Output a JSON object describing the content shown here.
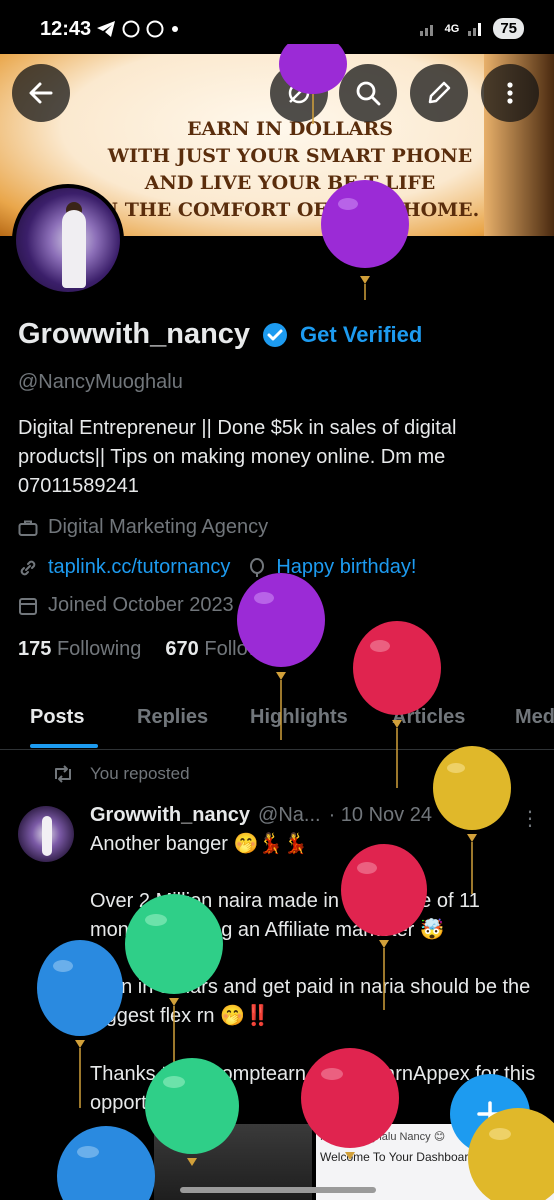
{
  "status_bar": {
    "time": "12:43",
    "battery": "75",
    "network": "4G"
  },
  "banner": {
    "lines": [
      "EARN IN DOLLARS",
      "WITH JUST YOUR SMART PHONE",
      "AND LIVE YOUR BE T LIFE",
      "N THE COMFORT OF YOUR HOME."
    ]
  },
  "profile": {
    "display_name": "Growwith_nancy",
    "get_verified": "Get Verified",
    "handle": "@NancyMuoghalu",
    "bio": "Digital Entrepreneur || Done $5k in sales of digital products|| Tips on making money online. Dm me 07011589241",
    "category": "Digital Marketing Agency",
    "website": "taplink.cc/tutornancy",
    "birthday": "Happy birthday!",
    "joined": "Joined October 2023",
    "following_count": "175",
    "following_label": "Following",
    "followers_count": "670",
    "followers_label": "Followers"
  },
  "tabs": [
    "Posts",
    "Replies",
    "Highlights",
    "Articles",
    "Med"
  ],
  "post": {
    "repost_label": "You reposted",
    "author": "Growwith_nancy",
    "handle_trunc": "@Na...",
    "date": "· 10 Nov 24",
    "line1": "Another banger 🤭💃💃",
    "line2": "Over 2 Million naira made in the space of 11 months of being an Affiliate marketer 🤯",
    "line3": "Earn in dollars and get paid in naria should be the biggest flex rn 🤭‼️",
    "line4": "Thanks to @promptearn and @EarnAppex for this opportunity 🥰",
    "media_line1": "Hello Muoghalu Nancy 😊",
    "media_line2": "Welcome To Your Dashboard"
  },
  "colors": {
    "accent": "#1d9bf0",
    "background": "#000000",
    "secondary_text": "#71767b"
  },
  "icons": [
    "back-arrow-icon",
    "grok-icon",
    "search-icon",
    "edit-icon",
    "more-vertical-icon",
    "verified-badge-icon",
    "briefcase-icon",
    "link-icon",
    "balloon-icon",
    "calendar-icon",
    "repost-icon",
    "compose-plus-icon"
  ]
}
